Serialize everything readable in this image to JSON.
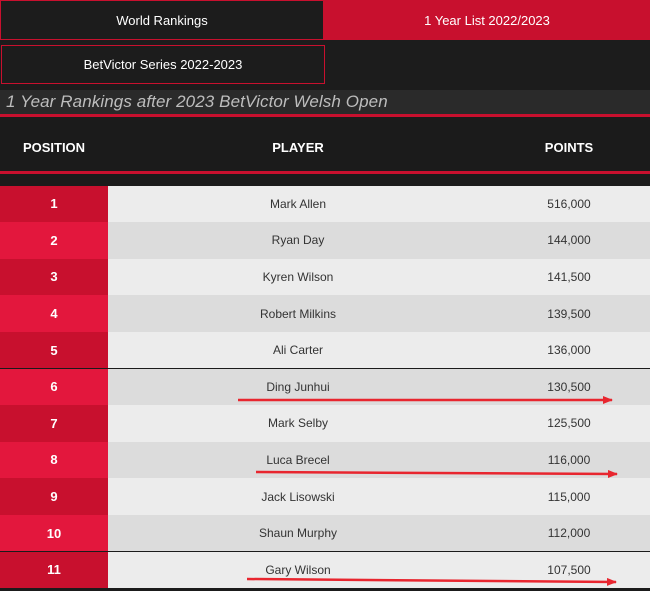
{
  "tabs": {
    "world_rankings": "World Rankings",
    "one_year_list": "1 Year List 2022/2023",
    "series": "BetVictor Series 2022-2023"
  },
  "subtitle": "1 Year Rankings after 2023 BetVictor Welsh Open",
  "table": {
    "headers": {
      "position": "POSITION",
      "player": "PLAYER",
      "points": "POINTS"
    },
    "rows": [
      {
        "position": "1",
        "player": "Mark Allen",
        "points": "516,000"
      },
      {
        "position": "2",
        "player": "Ryan Day",
        "points": "144,000"
      },
      {
        "position": "3",
        "player": "Kyren Wilson",
        "points": "141,500"
      },
      {
        "position": "4",
        "player": "Robert Milkins",
        "points": "139,500"
      },
      {
        "position": "5",
        "player": "Ali Carter",
        "points": "136,000"
      },
      {
        "position": "6",
        "player": "Ding Junhui",
        "points": "130,500"
      },
      {
        "position": "7",
        "player": "Mark Selby",
        "points": "125,500"
      },
      {
        "position": "8",
        "player": "Luca Brecel",
        "points": "116,000"
      },
      {
        "position": "9",
        "player": "Jack Lisowski",
        "points": "115,000"
      },
      {
        "position": "10",
        "player": "Shaun Murphy",
        "points": "112,000"
      },
      {
        "position": "11",
        "player": "Gary Wilson",
        "points": "107,500"
      }
    ]
  },
  "annotations": {
    "arrow_color": "#e8262f",
    "highlighted_players": [
      "Ding Junhui",
      "Luca Brecel",
      "Gary Wilson"
    ]
  },
  "colors": {
    "accent": "#c8102e",
    "accent_light": "#e3173d",
    "dark_bg": "#1b1b1b"
  }
}
